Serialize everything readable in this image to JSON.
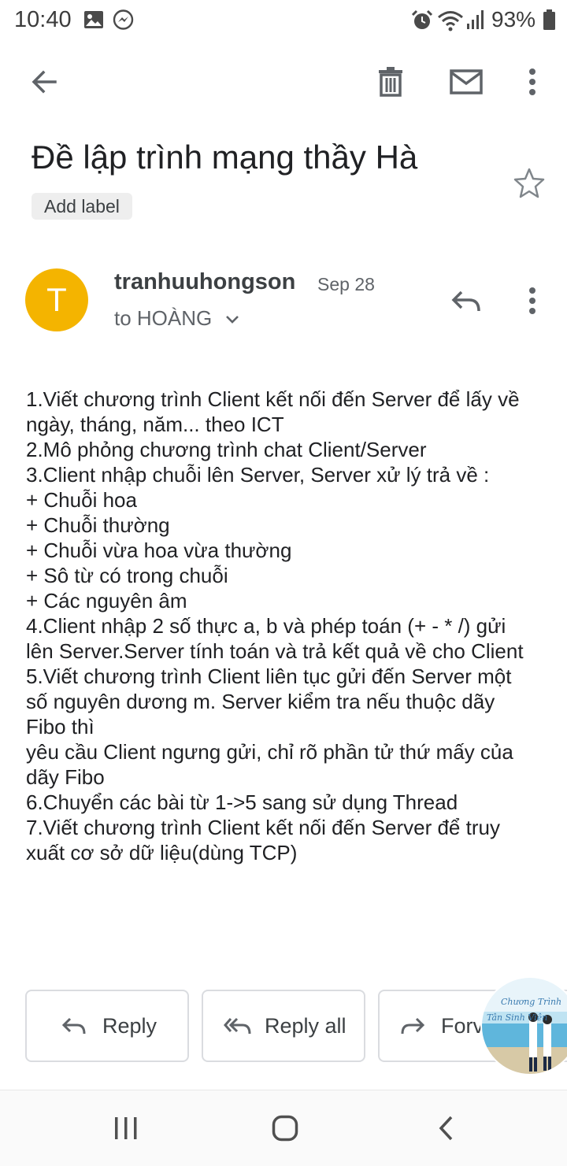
{
  "status_bar": {
    "time": "10:40",
    "battery": "93%",
    "left_icons": [
      "image-icon",
      "messenger-icon"
    ],
    "right_icons": [
      "alarm-icon",
      "wifi-icon",
      "signal-icon",
      "battery-icon"
    ]
  },
  "toolbar": {
    "icons": [
      "back-arrow-icon",
      "delete-icon",
      "mark-unread-icon",
      "more-vert-icon"
    ]
  },
  "email": {
    "subject": "Đề lập trình mạng thầy Hà",
    "add_label": "Add label",
    "sender": {
      "avatar_initial": "T",
      "avatar_color": "#f4b400",
      "name": "tranhuuhongson",
      "date": "Sep 28",
      "recipient": "to HOÀNG"
    },
    "body_lines": [
      "1.Viết chương trình Client kết nối đến Server để lấy về",
      "ngày, tháng, năm... theo ICT",
      "2.Mô phỏng chương trình chat Client/Server",
      "3.Client nhập chuỗi lên Server, Server xử lý trả về :",
      "+ Chuỗi hoa",
      "+ Chuỗi thường",
      "+ Chuỗi vừa hoa vừa thường",
      "+ Sô từ có trong chuỗi",
      "+ Các nguyên âm",
      "4.Client nhập 2 số thực a, b và phép toán (+ - * /) gửi",
      "lên Server.Server tính toán và trả kết quả về cho Client",
      "5.Viết chương trình Client liên tục gửi đến Server một",
      "số nguyên dương m. Server kiểm tra nếu thuộc dãy",
      "Fibo thì",
      "yêu cầu Client ngưng gửi, chỉ rõ phần tử thứ mấy của",
      "dãy Fibo",
      "6.Chuyển các bài từ 1->5 sang sử dụng Thread",
      "7.Viết chương trình Client kết nối đến Server để truy",
      "xuất cơ sở dữ liệu(dùng TCP)"
    ]
  },
  "actions": {
    "reply": "Reply",
    "reply_all": "Reply all",
    "forward": "Forv"
  },
  "chat_head": {
    "text_line1": "Chương Trình",
    "text_line2": "Tân Sinh Viên"
  },
  "nav_bar": {
    "icons": [
      "recent-apps-icon",
      "home-icon",
      "back-icon"
    ]
  }
}
